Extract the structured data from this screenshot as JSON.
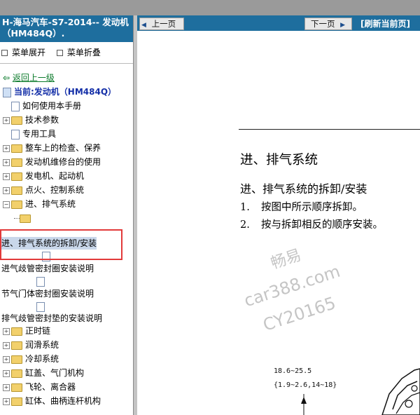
{
  "left": {
    "title": "H-海马汽车-S7-2014-- 发动机（HM484Q）.",
    "expand_label": "菜单展开",
    "collapse_label": "菜单折叠",
    "back_label": "返回上一级",
    "current_label": "当前:发动机（HM484Q）",
    "items": [
      {
        "label": "如何使用本手册",
        "type": "doc"
      },
      {
        "label": "技术参数",
        "type": "folder"
      },
      {
        "label": "专用工具",
        "type": "doc"
      },
      {
        "label": "整车上的检查、保养",
        "type": "folder"
      },
      {
        "label": "发动机维修台的使用",
        "type": "folder"
      },
      {
        "label": "发电机、起动机",
        "type": "folder"
      },
      {
        "label": "点火、控制系统",
        "type": "folder"
      },
      {
        "label": "进、排气系统",
        "type": "folder"
      }
    ],
    "sub_items": [
      "进、排气系统的拆卸/安装",
      "进气歧管密封圈安装说明",
      "节气门体密封圈安装说明",
      "排气歧管密封垫的安装说明"
    ],
    "items_after": [
      "正时链",
      "润滑系统",
      "冷却系统",
      "缸盖、气门机构",
      "飞轮、离合器",
      "缸体、曲柄连杆机构"
    ]
  },
  "nav": {
    "prev": "上一页",
    "next": "下一页",
    "refresh": "[刷新当前页]"
  },
  "content": {
    "title": "进、排气系统",
    "subtitle": "进、排气系统的拆卸/安装",
    "steps": [
      {
        "num": "1.",
        "text": "按图中所示顺序拆卸。"
      },
      {
        "num": "2.",
        "text": "按与拆卸相反的顺序安装。"
      }
    ],
    "torque1": "18.6~25.5",
    "torque2": "{1.9~2.6,14~18}",
    "watermark": [
      "畅易",
      "car388.com",
      "CY20165"
    ]
  }
}
